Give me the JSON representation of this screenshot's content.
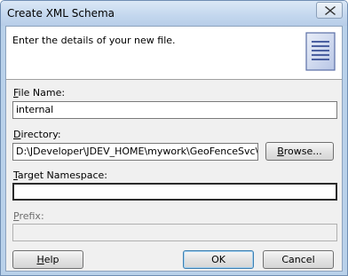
{
  "window": {
    "title": "Create XML Schema"
  },
  "header": {
    "instruction": "Enter the details of your new file."
  },
  "form": {
    "file_name": {
      "label_mnemonic": "F",
      "label_rest": "ile Name:",
      "value": "internal"
    },
    "directory": {
      "label_mnemonic": "D",
      "label_rest": "irectory:",
      "value": "D:\\JDeveloper\\JDEV_HOME\\mywork\\GeoFenceSvc\\xsd",
      "browse_mnemonic": "B",
      "browse_rest": "rowse..."
    },
    "target_namespace": {
      "label_mnemonic": "T",
      "label_rest": "arget Namespace:",
      "value": ""
    },
    "prefix": {
      "label_mnemonic": "P",
      "label_rest": "refix:",
      "value": ""
    }
  },
  "buttons": {
    "help_mnemonic": "H",
    "help_rest": "elp",
    "ok": "OK",
    "cancel": "Cancel"
  },
  "icons": {
    "close": "close-icon",
    "file": "document-lines-icon"
  }
}
